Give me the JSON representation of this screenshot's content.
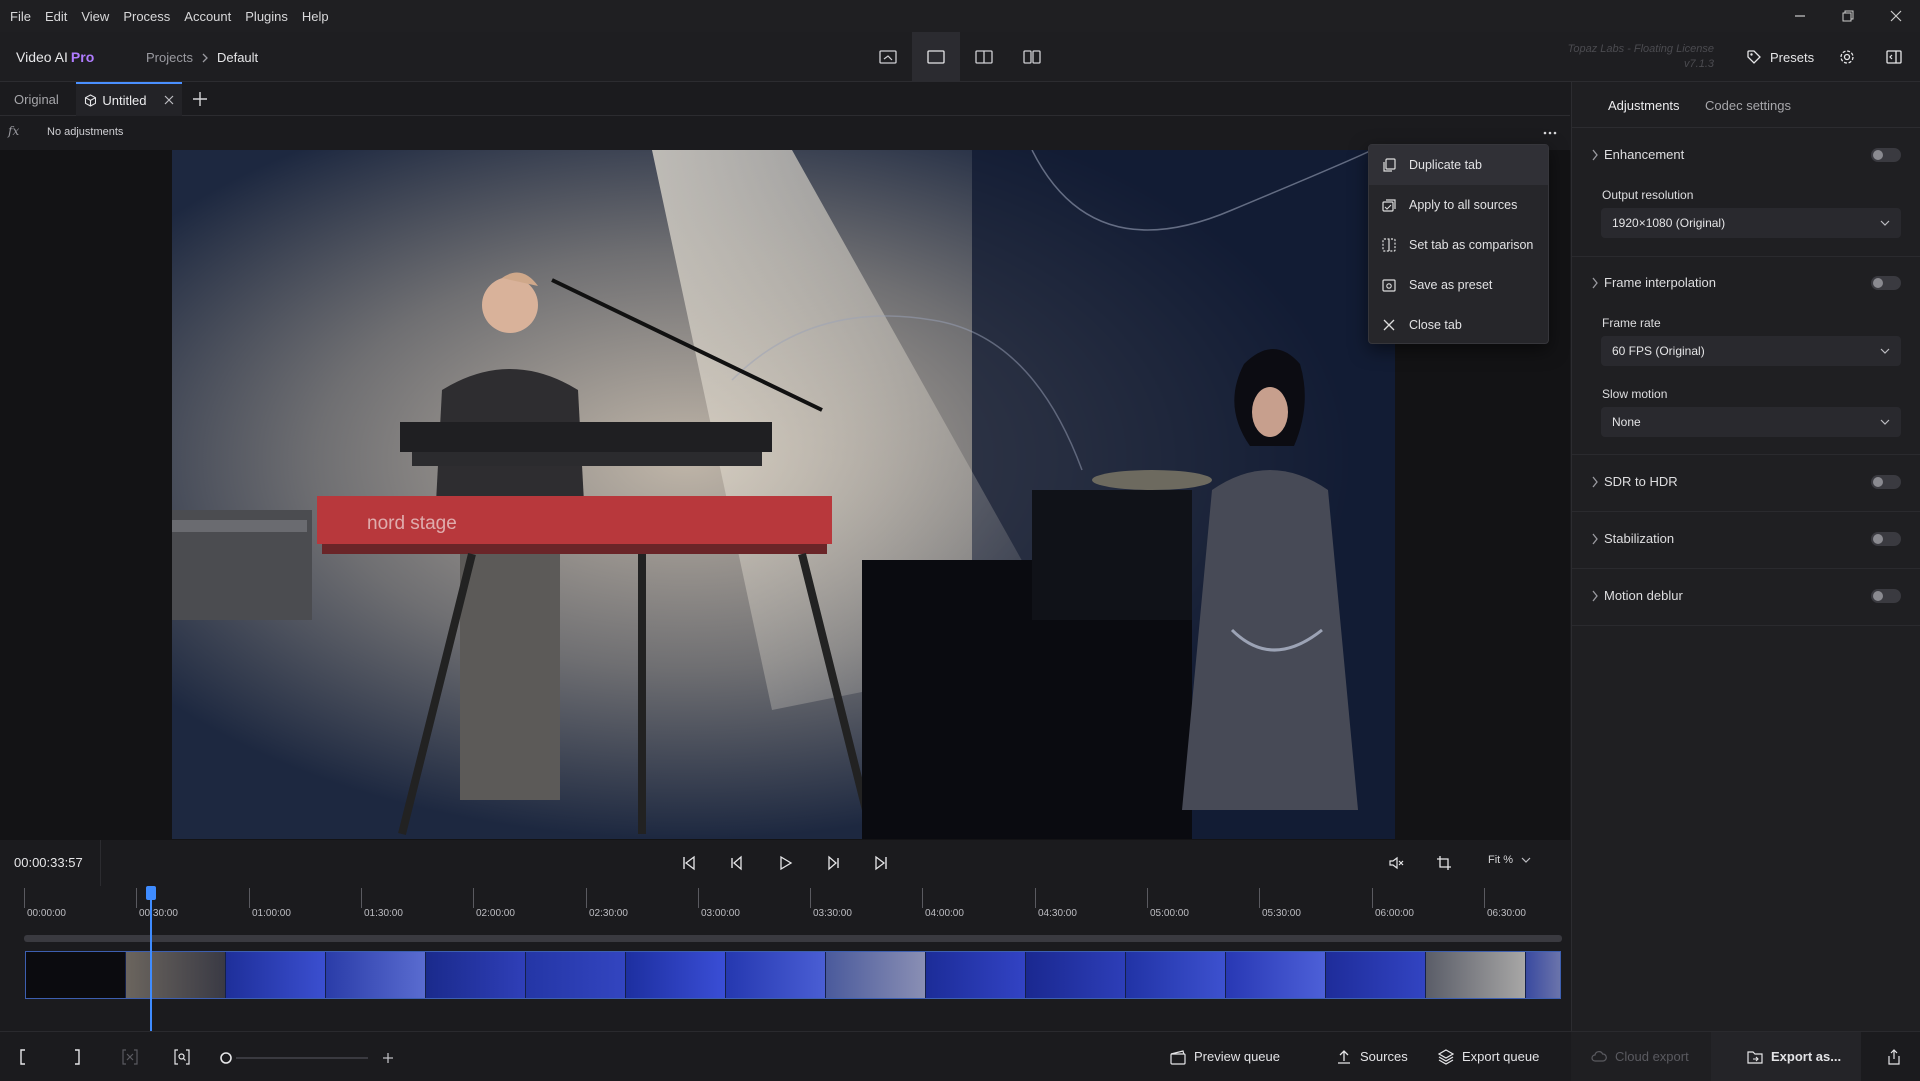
{
  "menubar": {
    "items": [
      "File",
      "Edit",
      "View",
      "Process",
      "Account",
      "Plugins",
      "Help"
    ]
  },
  "header": {
    "app_name": "Video AI",
    "app_edition": "Pro",
    "breadcrumb": [
      "Projects",
      "Default"
    ],
    "license_line1": "Topaz Labs - Floating License",
    "license_line2": "v7.1.3",
    "presets_label": "Presets"
  },
  "tabs": {
    "original": "Original",
    "untitled": "Untitled"
  },
  "adjustments_bar": {
    "fx": "fx",
    "text": "No adjustments"
  },
  "context_menu": {
    "items": [
      "Duplicate tab",
      "Apply to all sources",
      "Set tab as comparison",
      "Save as preset",
      "Close tab"
    ]
  },
  "transport": {
    "timecode": "00:00:33:57",
    "zoom_label": "Fit %"
  },
  "timeline": {
    "ticks": [
      "00:00:00",
      "00:30:00",
      "01:00:00",
      "01:30:00",
      "02:00:00",
      "02:30:00",
      "03:00:00",
      "03:30:00",
      "04:00:00",
      "04:30:00",
      "05:00:00",
      "05:30:00",
      "06:00:00",
      "06:30:00"
    ]
  },
  "bottombar": {
    "preview_queue": "Preview queue",
    "sources": "Sources",
    "export_queue": "Export queue",
    "cloud_export": "Cloud export",
    "export_as": "Export as..."
  },
  "side_panel": {
    "tab_adjustments": "Adjustments",
    "tab_codec": "Codec settings",
    "enhancement": "Enhancement",
    "output_resolution_label": "Output resolution",
    "output_resolution_value": "1920×1080 (Original)",
    "frame_interpolation": "Frame interpolation",
    "frame_rate_label": "Frame rate",
    "frame_rate_value": "60 FPS (Original)",
    "slow_motion_label": "Slow motion",
    "slow_motion_value": "None",
    "sdr_to_hdr": "SDR to HDR",
    "stabilization": "Stabilization",
    "motion_deblur": "Motion deblur"
  },
  "colors": {
    "accent": "#3f8cff",
    "pro": "#b07cff",
    "panel": "#1f1f22"
  }
}
